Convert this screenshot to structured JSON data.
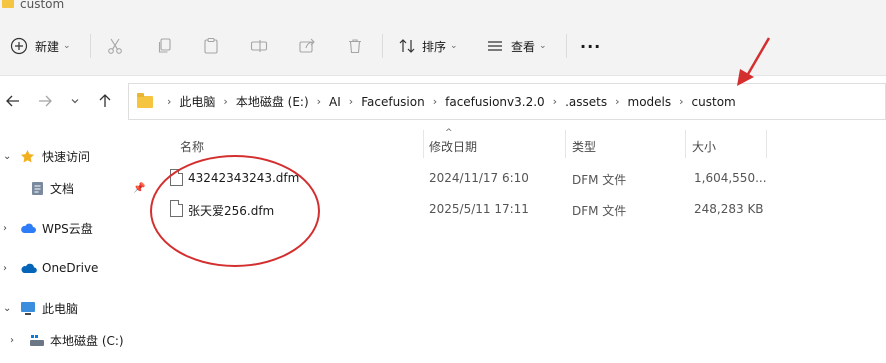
{
  "window": {
    "title": "custom"
  },
  "toolbar": {
    "new_label": "新建",
    "sort_label": "排序",
    "view_label": "查看",
    "more_label": "···"
  },
  "breadcrumb": [
    "此电脑",
    "本地磁盘 (E:)",
    "AI",
    "Facefusion",
    "facefusionv3.2.0",
    ".assets",
    "models",
    "custom"
  ],
  "sidebar": {
    "items": [
      {
        "label": "快速访问",
        "icon": "star-icon"
      },
      {
        "label": "文档",
        "icon": "document-icon"
      },
      {
        "label": "WPS云盘",
        "icon": "wps-cloud-icon"
      },
      {
        "label": "OneDrive",
        "icon": "onedrive-icon"
      },
      {
        "label": "此电脑",
        "icon": "computer-icon"
      },
      {
        "label": "本地磁盘 (C:)",
        "icon": "drive-icon"
      }
    ]
  },
  "columns": {
    "name": "名称",
    "modified": "修改日期",
    "type": "类型",
    "size": "大小"
  },
  "files": [
    {
      "name": "43242343243.dfm",
      "modified": "2024/11/17 6:10",
      "type": "DFM 文件",
      "size": "1,604,550..."
    },
    {
      "name": "张天爱256.dfm",
      "modified": "2025/5/11 17:11",
      "type": "DFM 文件",
      "size": "248,283 KB"
    }
  ],
  "colors": {
    "annotation": "#d32f2f",
    "folder": "#f5c542",
    "accent": "#0078d4"
  }
}
